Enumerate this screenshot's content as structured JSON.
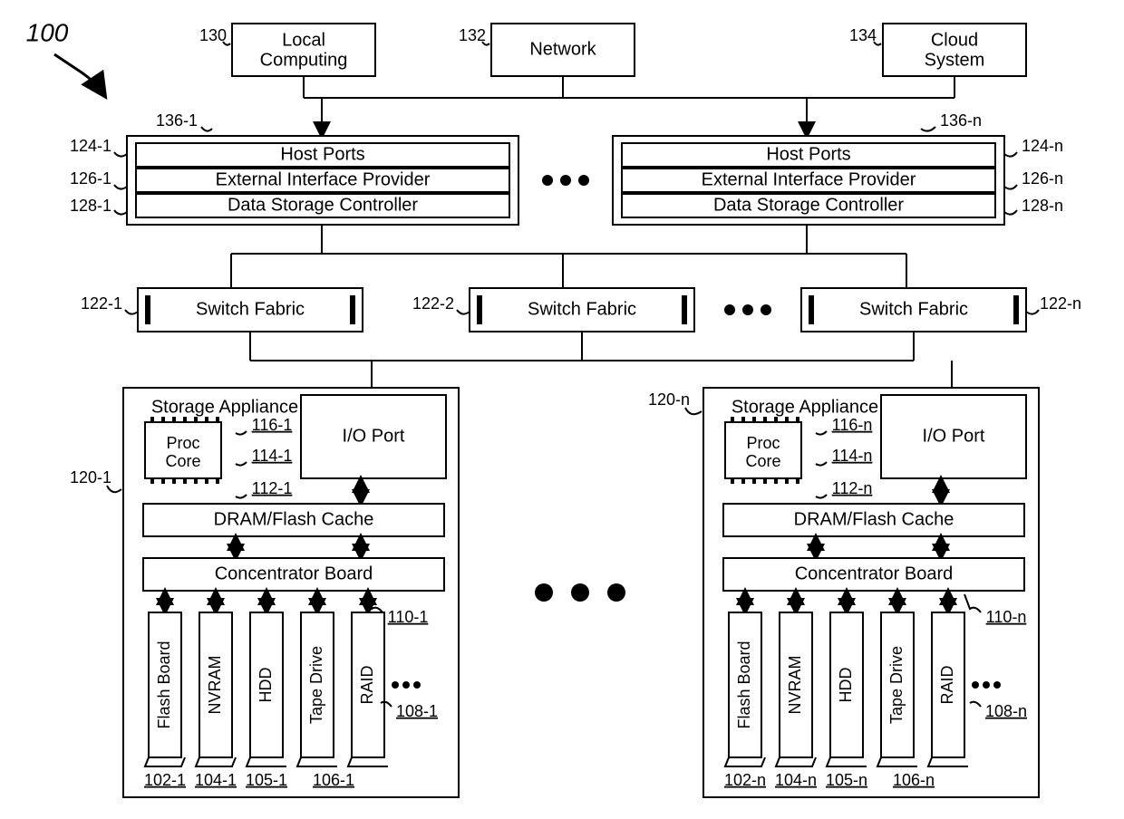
{
  "title": "100",
  "top": {
    "local_ref": "130",
    "local": [
      "Local",
      "Computing"
    ],
    "net_ref": "132",
    "net": "Network",
    "cloud_ref": "134",
    "cloud": [
      "Cloud",
      "System"
    ]
  },
  "ctrl_left": {
    "box_ref": "136-1",
    "hp_ref": "124-1",
    "hp": "Host Ports",
    "eip_ref": "126-1",
    "eip": "External Interface Provider",
    "dsc_ref": "128-1",
    "dsc": "Data Storage Controller"
  },
  "ctrl_right": {
    "box_ref": "136-n",
    "hp_ref": "124-n",
    "hp": "Host Ports",
    "eip_ref": "126-n",
    "eip": "External Interface Provider",
    "dsc_ref": "128-n",
    "dsc": "Data Storage Controller"
  },
  "sf": {
    "label": "Switch Fabric",
    "ref1": "122-1",
    "ref2": "122-2",
    "refn": "122-n"
  },
  "appliance": {
    "title": "Storage Appliance",
    "proc": [
      "Proc",
      "Core"
    ],
    "io": "I/O Port",
    "dram": "DRAM/Flash Cache",
    "conc": "Concentrator Board",
    "drives": [
      "Flash Board",
      "NVRAM",
      "HDD",
      "Tape Drive",
      "RAID"
    ]
  },
  "left": {
    "box_ref": "120-1",
    "ref116": "116-1",
    "ref114": "114-1",
    "ref112": "112-1",
    "ref110": "110-1",
    "ref108": "108-1",
    "ref102": "102-1",
    "ref104": "104-1",
    "ref105": "105-1",
    "ref106": "106-1"
  },
  "right": {
    "box_ref": "120-n",
    "ref116": "116-n",
    "ref114": "114-n",
    "ref112": "112-n",
    "ref110": "110-n",
    "ref108": "108-n",
    "ref102": "102-n",
    "ref104": "104-n",
    "ref105": "105-n",
    "ref106": "106-n"
  }
}
